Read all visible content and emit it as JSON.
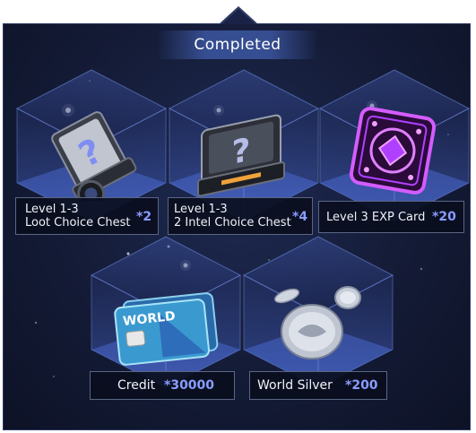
{
  "header": {
    "title": "Completed"
  },
  "rewards": [
    {
      "name_line1": "Level 1-3",
      "name_line2": "Loot Choice Chest",
      "quantity": "*2",
      "icon": "loot-choice-chest-icon"
    },
    {
      "name_line1": "Level 1-3",
      "name_line2": "2 Intel Choice Chest",
      "quantity": "*4",
      "icon": "intel-choice-chest-icon"
    },
    {
      "name": "Level 3 EXP Card",
      "quantity": "*20",
      "icon": "exp-card-icon"
    },
    {
      "name": "Credit",
      "quantity": "*30000",
      "icon": "credit-card-icon",
      "card_text": "WORLD"
    },
    {
      "name": "World Silver",
      "quantity": "*200",
      "icon": "silver-coins-icon"
    }
  ],
  "colors": {
    "panel_bg": "#141b36",
    "quantity": "#8a9cff",
    "exp_card": "#b040ff",
    "credit_card": "#5fd0e8"
  }
}
